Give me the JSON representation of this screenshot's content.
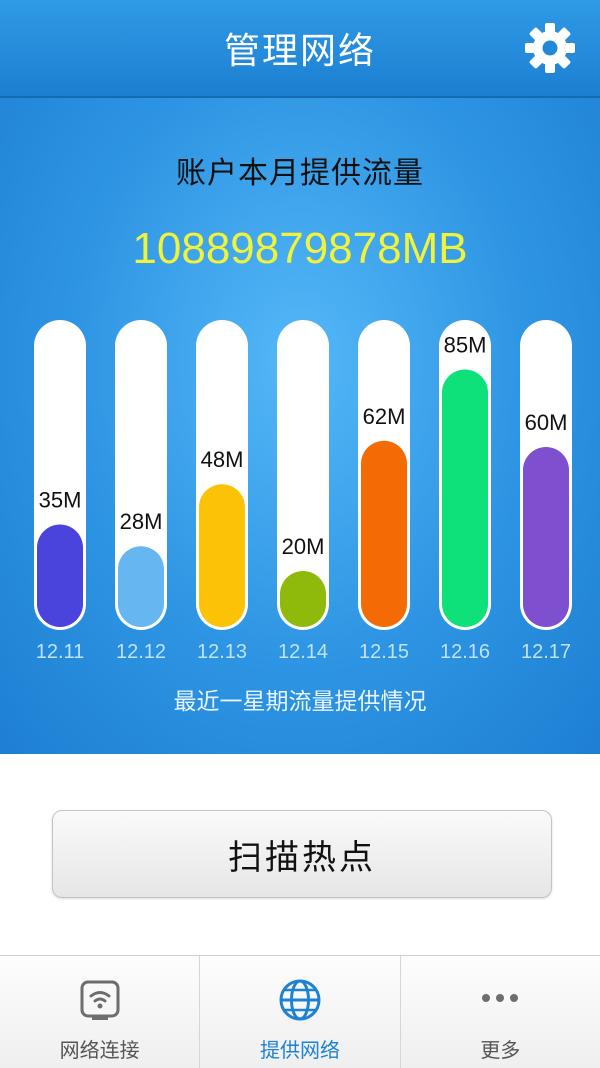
{
  "header": {
    "title": "管理网络",
    "settings_icon": "gear-icon"
  },
  "summary": {
    "headline": "账户本月提供流量",
    "total": "10889879878MB",
    "caption": "最近一星期流量提供情况"
  },
  "chart_data": {
    "type": "bar",
    "categories": [
      "12.11",
      "12.12",
      "12.13",
      "12.14",
      "12.15",
      "12.16",
      "12.17"
    ],
    "values": [
      35,
      28,
      48,
      20,
      62,
      85,
      60
    ],
    "value_labels": [
      "35M",
      "28M",
      "48M",
      "20M",
      "62M",
      "85M",
      "60M"
    ],
    "colors": [
      "#4b44dc",
      "#66b6f2",
      "#fbc206",
      "#8fba0c",
      "#f26b04",
      "#0ee07a",
      "#7e4fcf"
    ],
    "ylim": [
      0,
      100
    ],
    "xlabel": "",
    "ylabel": "",
    "title": ""
  },
  "actions": {
    "scan_label": "扫描热点"
  },
  "tabs": [
    {
      "label": "网络连接",
      "icon": "router-icon",
      "active": false
    },
    {
      "label": "提供网络",
      "icon": "globe-icon",
      "active": true
    },
    {
      "label": "更多",
      "icon": "more-dots-icon",
      "active": false
    }
  ]
}
